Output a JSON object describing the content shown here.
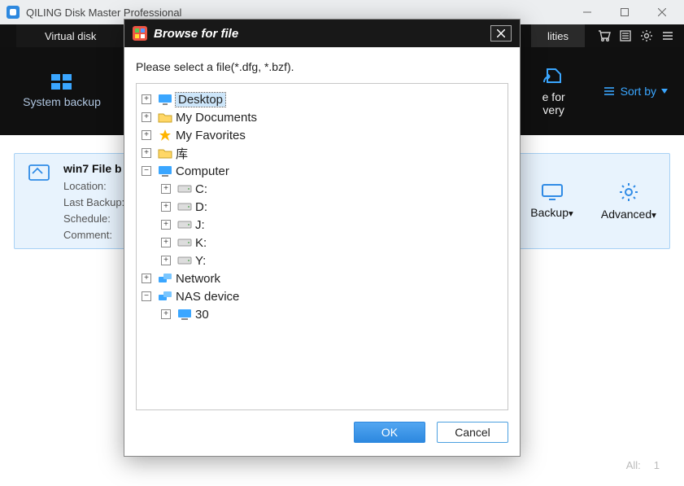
{
  "window": {
    "title": "QILING Disk Master Professional"
  },
  "tabs": {
    "virtual": "Virtual disk",
    "utilities": "lities"
  },
  "nav": {
    "system_backup": "System backup",
    "for_very": "e for\nvery",
    "sortby": "Sort by"
  },
  "card": {
    "title": "win7 File b",
    "location": "Location:",
    "last_backup": "Last Backup:",
    "schedule": "Schedule:",
    "comment": "Comment:",
    "backup": "Backup",
    "advanced": "Advanced"
  },
  "footer": {
    "all_label": "All:",
    "all_value": "1"
  },
  "dialog": {
    "title": "Browse for file",
    "prompt": "Please select a file(*.dfg, *.bzf).",
    "ok": "OK",
    "cancel": "Cancel",
    "tree": {
      "desktop": "Desktop",
      "mydocs": "My Documents",
      "myfav": "My Favorites",
      "ku": "库",
      "computer": "Computer",
      "c": "C:",
      "d": "D:",
      "j": "J:",
      "k": "K:",
      "y": "Y:",
      "network": "Network",
      "nas": "NAS device",
      "thirty": "30"
    }
  }
}
